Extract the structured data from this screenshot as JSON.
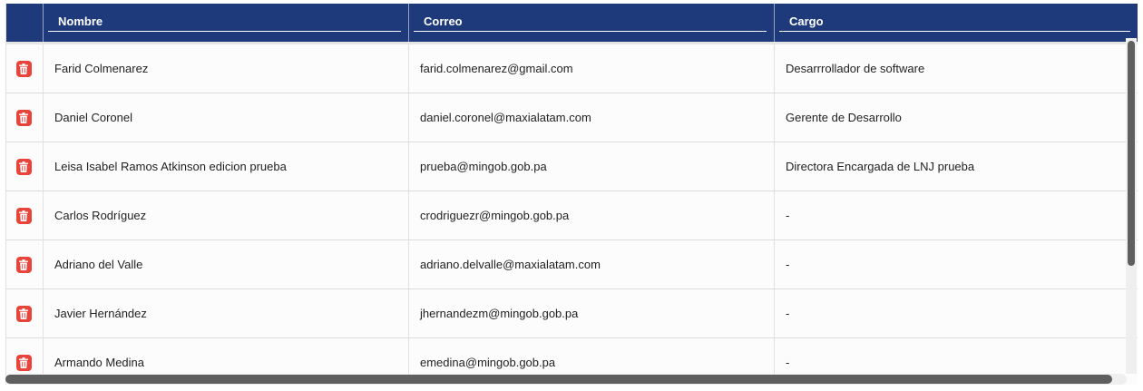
{
  "table": {
    "columns": [
      "",
      "Nombre",
      "Correo",
      "Cargo"
    ],
    "rows": [
      {
        "nombre": "Farid Colmenarez",
        "correo": "farid.colmenarez@gmail.com",
        "cargo": "Desarrrollador de software"
      },
      {
        "nombre": "Daniel Coronel",
        "correo": "daniel.coronel@maxialatam.com",
        "cargo": "Gerente de Desarrollo"
      },
      {
        "nombre": "Leisa Isabel Ramos Atkinson edicion prueba",
        "correo": "prueba@mingob.gob.pa",
        "cargo": "Directora Encargada de LNJ prueba"
      },
      {
        "nombre": "Carlos Rodríguez",
        "correo": "crodriguezr@mingob.gob.pa",
        "cargo": "-"
      },
      {
        "nombre": "Adriano del Valle",
        "correo": "adriano.delvalle@maxialatam.com",
        "cargo": "-"
      },
      {
        "nombre": "Javier Hernández",
        "correo": "jhernandezm@mingob.gob.pa",
        "cargo": "-"
      },
      {
        "nombre": "Armando Medina",
        "correo": "emedina@mingob.gob.pa",
        "cargo": "-"
      }
    ]
  },
  "icons": {
    "delete": "trash-icon"
  },
  "colors": {
    "header_bg": "#1e3a7b",
    "delete_icon": "#e8443a"
  }
}
